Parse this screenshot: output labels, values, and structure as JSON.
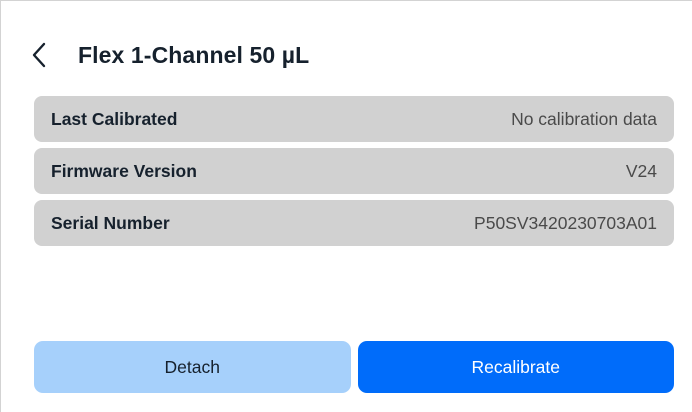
{
  "header": {
    "back_icon": "chevron-left-icon",
    "title": "Flex 1-Channel 50 µL"
  },
  "details": [
    {
      "label": "Last Calibrated",
      "value": "No calibration data"
    },
    {
      "label": "Firmware Version",
      "value": "V24"
    },
    {
      "label": "Serial Number",
      "value": "P50SV3420230703A01"
    }
  ],
  "actions": {
    "detach_label": "Detach",
    "recalibrate_label": "Recalibrate"
  },
  "colors": {
    "row_background": "#d1d1d1",
    "secondary_button": "#a6d0fb",
    "primary_button": "#006cfa",
    "text": "#16212d"
  }
}
